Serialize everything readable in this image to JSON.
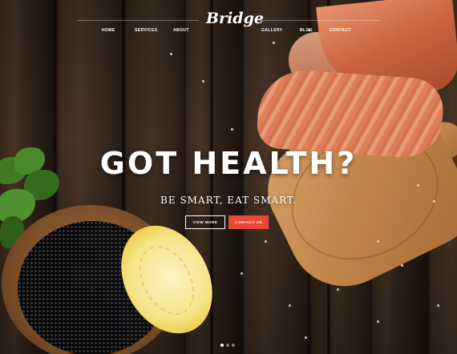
{
  "brand": {
    "logo_text": "Bridge"
  },
  "nav": {
    "items_left": [
      "HOME",
      "SERVICES",
      "ABOUT"
    ],
    "items_right": [
      "GALLERY",
      "BLOG",
      "CONTACT"
    ]
  },
  "hero": {
    "headline": "GOT HEALTH?",
    "subheadline": "BE SMART, EAT SMART.",
    "primary_button": "VIEW MORE",
    "secondary_button": "CONTACT US",
    "slides": {
      "count": 3,
      "active_index": 0
    }
  },
  "colors": {
    "accent": "#e8483a",
    "text": "#ffffff"
  },
  "decor": {
    "background": "dark wooden table",
    "foods": [
      "smoked salmon on wooden board",
      "black caviar in wooden bowl",
      "lemon slice",
      "parsley"
    ]
  }
}
